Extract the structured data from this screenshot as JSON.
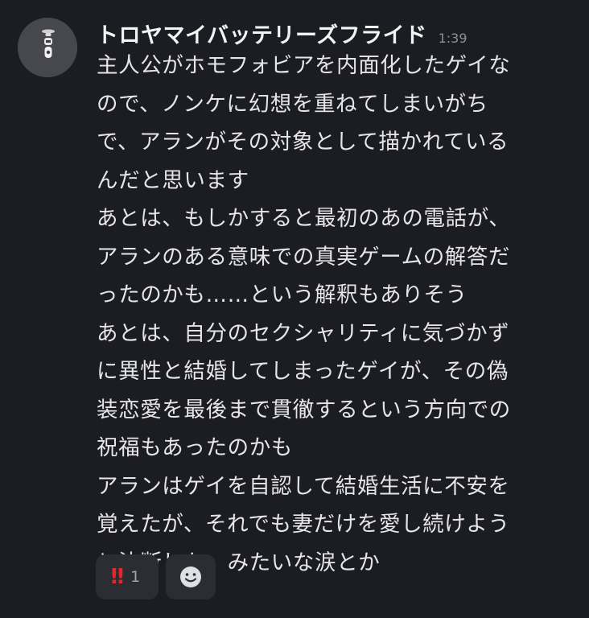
{
  "message": {
    "username": "トロヤマイバッテリーズフライド",
    "timestamp": "1:39",
    "lines": [
      "主人公がホモフォビアを内面化したゲイな",
      "ので、ノンケに幻想を重ねてしまいがち",
      "で、アランがその対象として描かれている",
      "んだと思います",
      "あとは、もしかすると最初のあの電話が、",
      "アランのある意味での真実ゲームの解答だ",
      "ったのかも……という解釈もありそう",
      "あとは、自分のセクシャリティに気づかず",
      "に異性と結婚してしまったゲイが、その偽",
      "装恋愛を最後まで貫徹するという方向での",
      "祝福もあったのかも",
      "アランはゲイを自認して結婚生活に不安を",
      "覚えたが、それでも妻だけを愛し続けよう",
      "と決断した、みたいな涙とか"
    ],
    "reactions": [
      {
        "emoji": "‼",
        "count": "1",
        "icon": "double-exclamation-emoji"
      }
    ],
    "add_reaction_icon": "smiley-add-reaction-icon"
  },
  "colors": {
    "background": "#1c1d22",
    "text": "#e6e6e8",
    "username": "#f2f3f5",
    "timestamp": "#8e9097",
    "reaction_bg": "#2b2d33",
    "emoji_red": "#e7252c"
  }
}
